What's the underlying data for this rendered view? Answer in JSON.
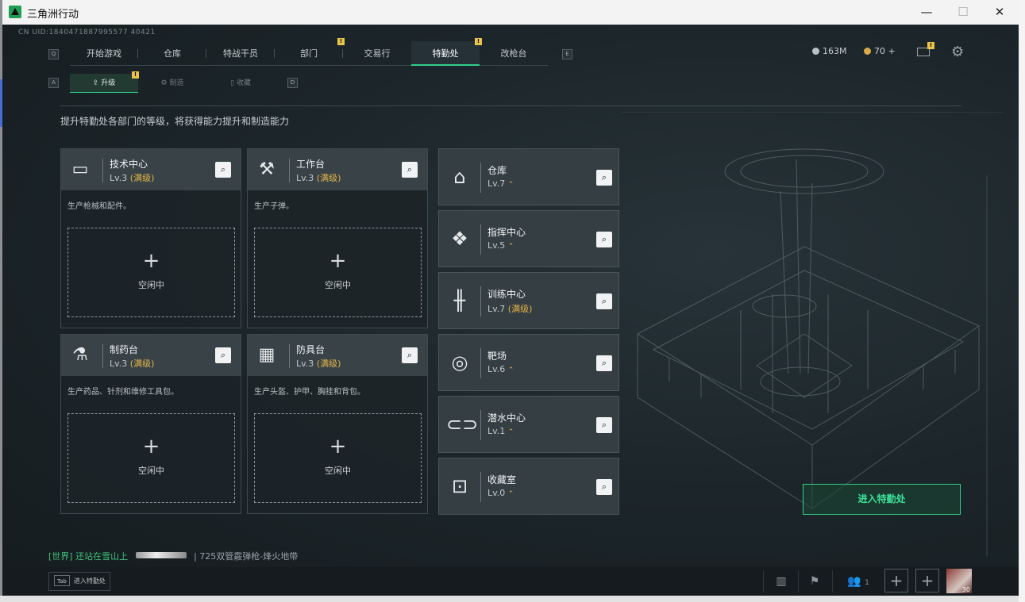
{
  "window": {
    "title": "三角洲行动",
    "minimize": "—",
    "maximize": "☐",
    "close": "✕"
  },
  "uid": "CN UID:1840471887995577 40421",
  "nav": {
    "key_left": "Q",
    "key_right": "E",
    "tabs": [
      "开始游戏",
      "仓库",
      "特战干员",
      "部门",
      "交易行",
      "特勤处",
      "改枪台"
    ],
    "active": "特勤处"
  },
  "currency": {
    "silver": "163M",
    "gold": "70 +"
  },
  "subnav": {
    "key_left": "A",
    "key_right": "D",
    "tabs": [
      "升级",
      "制造",
      "收藏"
    ],
    "active": "升级"
  },
  "description": "提升特勤处各部门的等级，将获得能力提升和制造能力",
  "workstations": [
    {
      "name": "技术中心",
      "level": "Lv.3",
      "status": "(满级)",
      "desc": "生产枪械和配件。",
      "idle_text": "空闲中"
    },
    {
      "name": "工作台",
      "level": "Lv.3",
      "status": "(满级)",
      "desc": "生产子弹。",
      "idle_text": "空闲中"
    },
    {
      "name": "制药台",
      "level": "Lv.3",
      "status": "(满级)",
      "desc": "生产药品、针剂和维修工具包。",
      "idle_text": "空闲中"
    },
    {
      "name": "防具台",
      "level": "Lv.3",
      "status": "(满级)",
      "desc": "生产头盔、护甲、胸挂和背包。",
      "idle_text": "空闲中"
    }
  ],
  "facilities": [
    {
      "name": "仓库",
      "level": "Lv.7",
      "status": "",
      "upgradable": true
    },
    {
      "name": "指挥中心",
      "level": "Lv.5",
      "status": "",
      "upgradable": true
    },
    {
      "name": "训练中心",
      "level": "Lv.7",
      "status": "(满级)",
      "upgradable": false
    },
    {
      "name": "靶场",
      "level": "Lv.6",
      "status": "",
      "upgradable": true
    },
    {
      "name": "潜水中心",
      "level": "Lv.1",
      "status": "",
      "upgradable": true
    },
    {
      "name": "收藏室",
      "level": "Lv.0",
      "status": "",
      "upgradable": true
    }
  ],
  "enter_button": "进入特勤处",
  "chat": {
    "channel": "[世界]",
    "user": "还站在雪山上",
    "message": "| 725双管霰弹枪-烽火地带"
  },
  "bottom": {
    "tab_key": "Tab",
    "tab_label": "进入特勤处",
    "team_count": "1",
    "avatar_level": "30"
  },
  "colors": {
    "accent": "#2fd08a",
    "max_level": "#e3b548",
    "alert": "#e8c44b"
  }
}
